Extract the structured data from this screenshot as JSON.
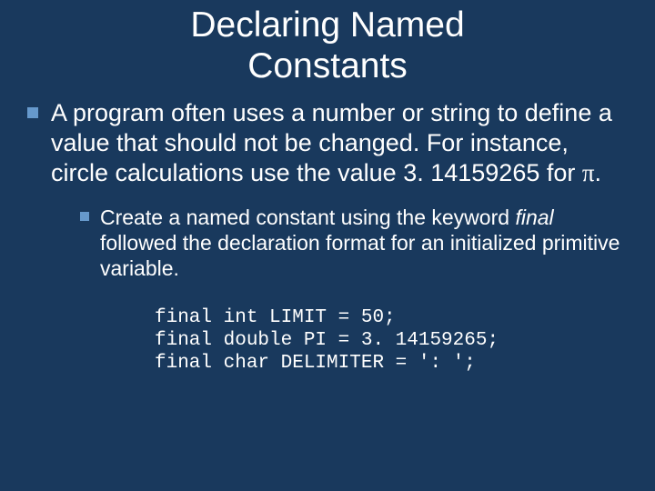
{
  "title_line1": "Declaring Named",
  "title_line2": "Constants",
  "body": {
    "pre_pi": "A program often uses a number or string to define a value that should not be changed. For instance, circle calculations use the value 3. 14159265 for ",
    "pi": "π",
    "post_pi": "."
  },
  "sub": {
    "pre_italic": "Create a named constant using the keyword ",
    "italic_word": "final",
    "post_italic": " followed the declaration format for an initialized primitive variable."
  },
  "code": {
    "line1": "final int LIMIT = 50;",
    "line2": "final double PI = 3. 14159265;",
    "line3": "final char DELIMITER = ': ';"
  }
}
